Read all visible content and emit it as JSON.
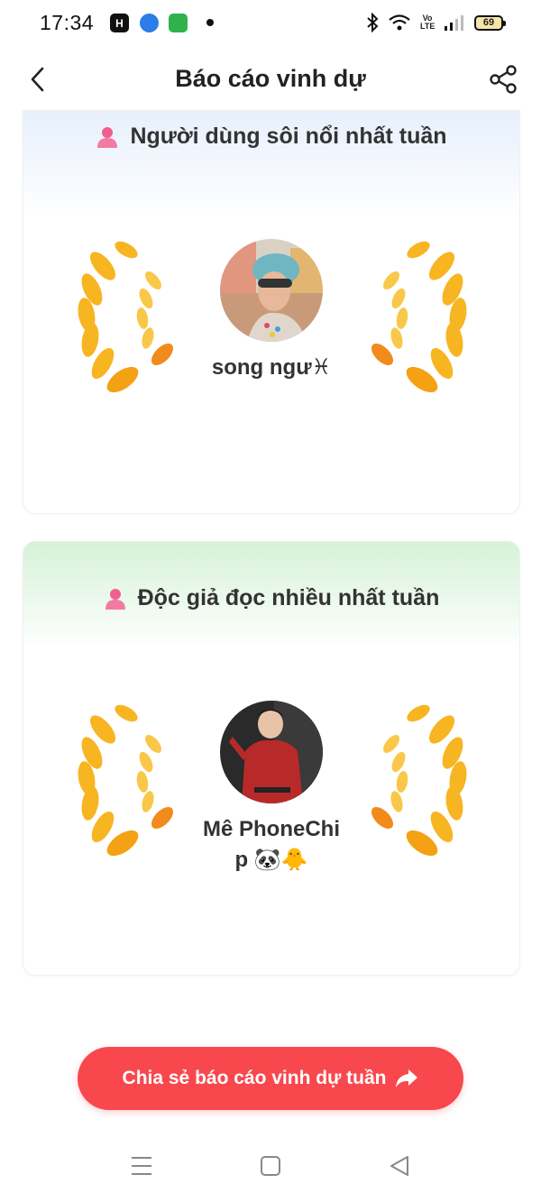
{
  "status_bar": {
    "time": "17:34",
    "battery": "69",
    "volte": "Vo LTE"
  },
  "header": {
    "title": "Báo cáo vinh dự"
  },
  "cards": [
    {
      "heading": "Người dùng sôi nổi nhất tuần",
      "name_line1": "song ngư♓",
      "name_line2": ""
    },
    {
      "heading": "Độc giả đọc nhiều nhất tuần",
      "name_line1": "Mê PhoneChi",
      "name_line2": "p 🐼🐥"
    }
  ],
  "cta": {
    "label": "Chia sẻ báo cáo vinh dự tuần"
  },
  "colors": {
    "accent": "#f9474e",
    "laurel": "#f7b521",
    "person_icon": "#f0608f"
  }
}
